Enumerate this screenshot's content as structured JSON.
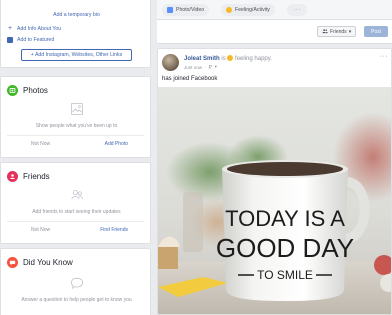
{
  "intro": {
    "add_temporary_bio": "Add a temporary bio",
    "add_info": "Add Info About You",
    "add_featured": "Add to Featured",
    "add_links_button": "+ Add Instagram, Websites, Other Links"
  },
  "photos": {
    "title": "Photos",
    "description": "Show people what you've been up to",
    "action_left": "Not Now",
    "action_right": "Add Photo"
  },
  "friends": {
    "title": "Friends",
    "description": "Add friends to start seeing their updates",
    "action_left": "Not Now",
    "action_right": "Find Friends"
  },
  "did_you_know": {
    "title": "Did You Know",
    "description": "Answer a question to help people get to know you"
  },
  "composer": {
    "photo_video": "Photo/Video",
    "feeling_activity": "Feeling/Activity",
    "more": "···",
    "audience": "Friends",
    "post_button": "Post"
  },
  "post": {
    "author": "Joleat Smith",
    "is_word": "is",
    "feeling": "feeling happy.",
    "time": "Just now",
    "more": "···",
    "text": "has joined Facebook",
    "mug_line1": "TODAY IS A",
    "mug_line2": "GOOD DAY",
    "mug_line3": "TO SMILE"
  },
  "colors": {
    "facebook_blue": "#4267b2",
    "photos_green": "#42b72a",
    "friends_pink": "#e3325c",
    "dyk_orange": "#f5533d"
  }
}
